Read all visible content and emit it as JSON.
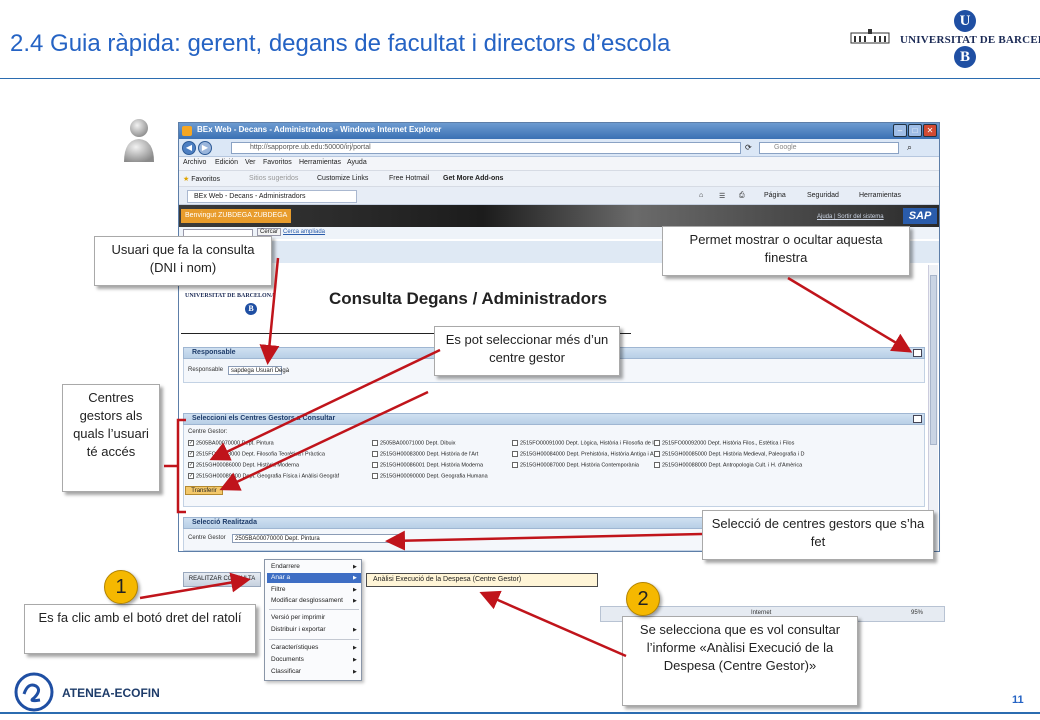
{
  "slide": {
    "title": "2.4 Guia ràpida: gerent, degans de facultat i directors d’escola",
    "university_name": "UNIVERSITAT DE BARCELONA",
    "logo_letters": [
      "U",
      "B"
    ],
    "page_number": "11",
    "footer_brand": "ATENEA-ECOFIN"
  },
  "browser": {
    "window_title": "BEx Web - Decans - Administradors - Windows Internet Explorer",
    "address": "http://sapporpre.ub.edu:50000/irj/portal",
    "search_placeholder": "Google",
    "menu": [
      "Archivo",
      "Edición",
      "Ver",
      "Favoritos",
      "Herramientas",
      "Ayuda"
    ],
    "favorites": [
      "Favoritos",
      "Sitios sugeridos",
      "Customize Links",
      "Free Hotmail",
      "Get More Add-ons"
    ],
    "tab_title": "BEx Web - Decans - Administradors",
    "tools": [
      "Página",
      "Seguridad",
      "Herramientas"
    ]
  },
  "sap": {
    "welcome": "Benvingut ZUBDEGA ZUBDEGA",
    "help_links": "Ajuda | Sortir del sistema",
    "logo": "SAP",
    "search_button": "Cercar",
    "search_advanced": "Cerca ampliada"
  },
  "report": {
    "title": "Consulta Degans / Administradors",
    "responsible_header": "Responsable",
    "responsible_label": "Responsable",
    "responsible_value": "sapdega Usuari Degà",
    "centres_header": "Seleccioni els Centres Gestors a Consultar",
    "centre_gestor_label": "Centre Gestor:",
    "options": [
      [
        "2505BA00070000 Dept. Pintura",
        "2505BA00071000 Dept. Dibuix",
        "2515FO00091000 Dept. Lògica, Història i Filosofia de la",
        "2515FO00092000 Dept. Història Filos., Estètica i Filos"
      ],
      [
        "2515FO00093000 Dept. Filosofia Teorètica i Pràctica",
        "2515GH00083000 Dept. Història de l'Art",
        "2515GH00084000 Dept. Prehistòria, Història Antiga i Arq",
        "2515GH00085000 Dept. Història Medieval, Paleografia i D"
      ],
      [
        "2515GH00086000 Dept. Història Moderna",
        "2515GH00086001 Dept. Història Moderna",
        "2515GH00087000 Dept. Història Contemporània",
        "2515GH00088000 Dept. Antropologia Cult. i H. d'Amèrica"
      ],
      [
        "2515GH00089000 Dept. Geografia Física i Anàlisi Geogràf",
        "2515GH00090000 Dept. Geografia Humana",
        "",
        ""
      ]
    ],
    "checked": [
      [
        true,
        false,
        false,
        false
      ],
      [
        true,
        false,
        false,
        false
      ],
      [
        true,
        false,
        false,
        false
      ],
      [
        true,
        false,
        false,
        false
      ]
    ],
    "transfer_button": "Transferir",
    "selection_header": "Selecció Realitzada",
    "selection_label": "Centre Gestor",
    "selection_value": "2505BA00070000 Dept. Pintura"
  },
  "context_menu": {
    "button": "REALITZAR CONSULTA",
    "items": [
      {
        "label": "Endarrere",
        "arrow": true
      },
      {
        "label": "Anar a",
        "arrow": true
      },
      {
        "label": "Filtre",
        "arrow": true
      },
      {
        "label": "Modificar desglossament",
        "arrow": true
      },
      {
        "label": "Versió per imprimir",
        "arrow": false
      },
      {
        "label": "Distribuir i exportar",
        "arrow": true
      },
      {
        "label": "Característiques",
        "arrow": true
      },
      {
        "label": "Documents",
        "arrow": true
      },
      {
        "label": "Classificar",
        "arrow": true
      }
    ],
    "submenu_item": "Anàlisi Execució de la Despesa (Centre Gestor)",
    "status_zoom": "95%",
    "status_zone": "Internet"
  },
  "callouts": {
    "user": "Usuari que fa la consulta (DNI i nom)",
    "toggle": "Permet  mostrar o ocultar aquesta finestra",
    "multi": "Es pot seleccionar més d’un centre gestor",
    "centres": "Centres gestors als quals l’usuari té accés",
    "selection": "Selecció de centres gestors que s’ha fet",
    "rightclick": "Es fa clic amb el botó dret del ratolí",
    "select_report": "Se selecciona que es vol consultar l’informe «Anàlisi Execució de la Despesa (Centre Gestor)»",
    "badge1": "1",
    "badge2": "2"
  },
  "colors": {
    "title_blue": "#2563c4",
    "arrow_red": "#c0141b",
    "badge_yellow": "#f5b800"
  }
}
